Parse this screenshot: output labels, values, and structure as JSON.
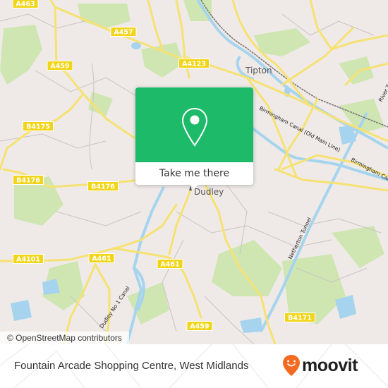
{
  "map": {
    "places": [
      {
        "name": "Tipton"
      },
      {
        "name": "Dudley"
      }
    ],
    "road_labels": [
      "A463",
      "A457",
      "A4123",
      "A459",
      "B4175",
      "B4176",
      "B4176",
      "A4101",
      "A461",
      "A461",
      "A459",
      "B4171"
    ],
    "water_labels": [
      "Birmingham Canal (Old Main Line)",
      "Birmingham Canal",
      "River Tame",
      "Netherton Tunnel",
      "Dudley No 1 Canal"
    ],
    "colors": {
      "land": "#efeae7",
      "park": "#cde6b0",
      "water": "#a6d4ee",
      "road": "#f6e272",
      "road_shield": "#f2d518",
      "rail": "#777777",
      "minor_road": "#c8c0bc"
    }
  },
  "popup": {
    "icon": "map-pin-icon",
    "cta_label": "Take me there",
    "color": "#1dba6a"
  },
  "attribution": "© OpenStreetMap contributors",
  "footer": {
    "title": "Fountain Arcade Shopping Centre, West Midlands",
    "logo_text": "moovit",
    "logo_color": "#f26b21"
  }
}
